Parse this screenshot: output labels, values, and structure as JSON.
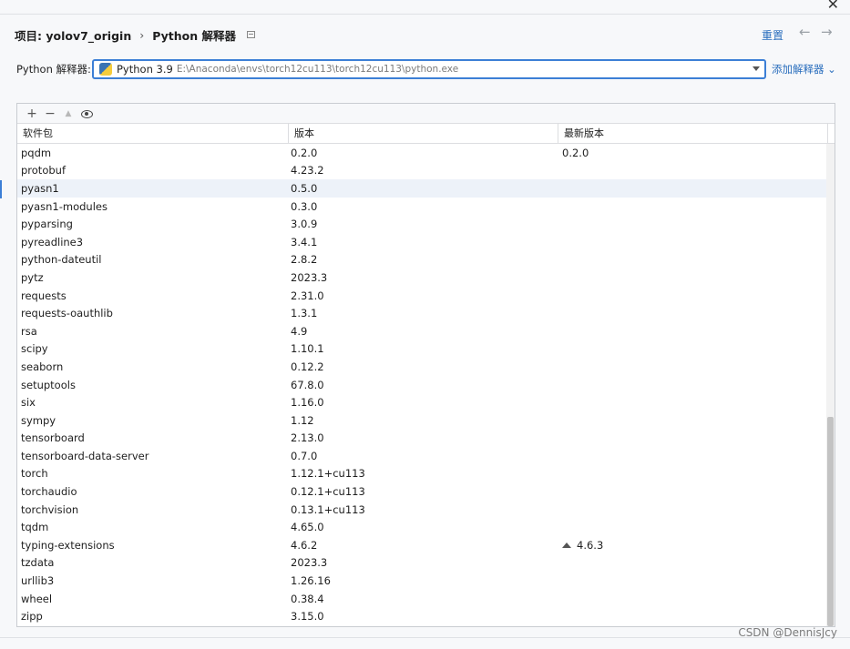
{
  "window": {
    "close_glyph": "✕"
  },
  "header": {
    "project": "项目: yolov7_origin",
    "separator": "›",
    "section": "Python 解释器",
    "reset": "重置",
    "back_glyph": "←",
    "forward_glyph": "→"
  },
  "interpreter": {
    "label": "Python 解释器:",
    "name": "Python 3.9",
    "path": "E:\\Anaconda\\envs\\torch12cu113\\torch12cu113\\python.exe",
    "add_label": "添加解释器 ⌄",
    "icon": "python-icon"
  },
  "toolbar": {
    "add": "+",
    "remove": "−",
    "upgrade": "▲"
  },
  "columns": {
    "package": "软件包",
    "version": "版本",
    "latest": "最新版本"
  },
  "packages": [
    {
      "name": "pqdm",
      "version": "0.2.0",
      "latest": "0.2.0"
    },
    {
      "name": "protobuf",
      "version": "4.23.2",
      "latest": ""
    },
    {
      "name": "pyasn1",
      "version": "0.5.0",
      "latest": ""
    },
    {
      "name": "pyasn1-modules",
      "version": "0.3.0",
      "latest": ""
    },
    {
      "name": "pyparsing",
      "version": "3.0.9",
      "latest": ""
    },
    {
      "name": "pyreadline3",
      "version": "3.4.1",
      "latest": ""
    },
    {
      "name": "python-dateutil",
      "version": "2.8.2",
      "latest": ""
    },
    {
      "name": "pytz",
      "version": "2023.3",
      "latest": ""
    },
    {
      "name": "requests",
      "version": "2.31.0",
      "latest": ""
    },
    {
      "name": "requests-oauthlib",
      "version": "1.3.1",
      "latest": ""
    },
    {
      "name": "rsa",
      "version": "4.9",
      "latest": ""
    },
    {
      "name": "scipy",
      "version": "1.10.1",
      "latest": ""
    },
    {
      "name": "seaborn",
      "version": "0.12.2",
      "latest": ""
    },
    {
      "name": "setuptools",
      "version": "67.8.0",
      "latest": ""
    },
    {
      "name": "six",
      "version": "1.16.0",
      "latest": ""
    },
    {
      "name": "sympy",
      "version": "1.12",
      "latest": ""
    },
    {
      "name": "tensorboard",
      "version": "2.13.0",
      "latest": ""
    },
    {
      "name": "tensorboard-data-server",
      "version": "0.7.0",
      "latest": ""
    },
    {
      "name": "torch",
      "version": "1.12.1+cu113",
      "latest": ""
    },
    {
      "name": "torchaudio",
      "version": "0.12.1+cu113",
      "latest": ""
    },
    {
      "name": "torchvision",
      "version": "0.13.1+cu113",
      "latest": ""
    },
    {
      "name": "tqdm",
      "version": "4.65.0",
      "latest": ""
    },
    {
      "name": "typing-extensions",
      "version": "4.6.2",
      "latest": "4.6.3",
      "upgradable": true
    },
    {
      "name": "tzdata",
      "version": "2023.3",
      "latest": ""
    },
    {
      "name": "urllib3",
      "version": "1.26.16",
      "latest": ""
    },
    {
      "name": "wheel",
      "version": "0.38.4",
      "latest": ""
    },
    {
      "name": "zipp",
      "version": "3.15.0",
      "latest": ""
    }
  ],
  "selected_row": 2,
  "watermark": "CSDN @DennisJcy",
  "colors": {
    "accent": "#3c7fd6",
    "link": "#2a6ebd",
    "selection": "#edf2f9"
  }
}
